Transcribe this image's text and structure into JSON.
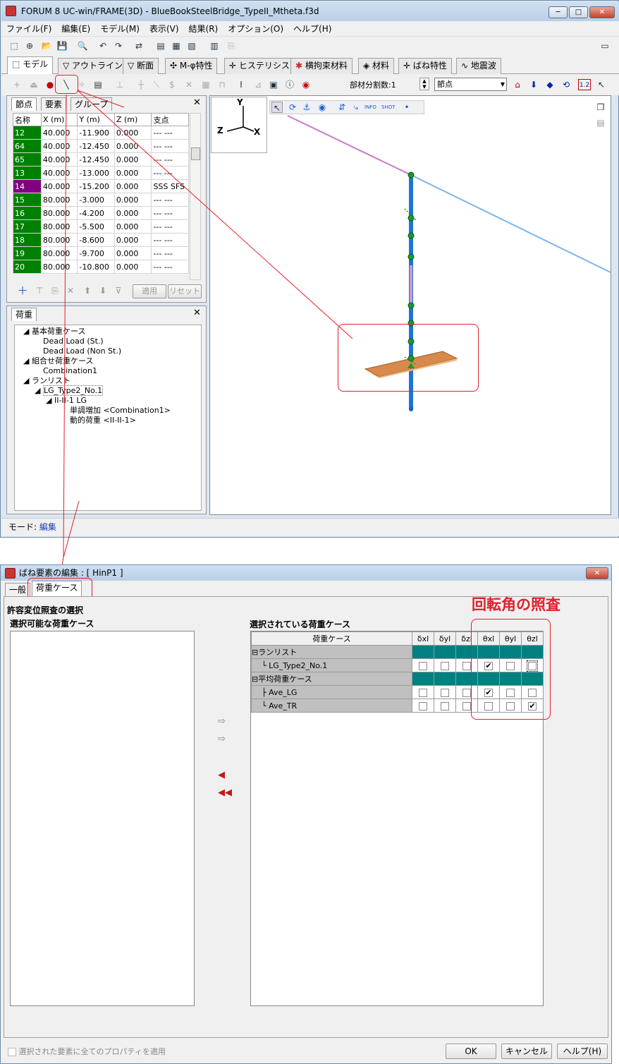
{
  "app": {
    "title": "FORUM 8  UC-win/FRAME(3D) - BlueBookSteelBridge_TypeII_Mtheta.f3d",
    "window_buttons": {
      "minimize": "─",
      "maximize": "□",
      "close": "✕"
    }
  },
  "menu": [
    "ファイル(F)",
    "編集(E)",
    "モデル(M)",
    "表示(V)",
    "結果(R)",
    "オプション(O)",
    "ヘルプ(H)"
  ],
  "main_tabs": [
    "モデル",
    "アウトライン",
    "断面",
    "M-φ特性",
    "ヒステリシス",
    "横拘束材料",
    "材料",
    "ばね特性",
    "地震波"
  ],
  "toolbar2": {
    "division_label": "部材分割数:1",
    "select_value": "節点",
    "tool_value": "1.2"
  },
  "node_panel": {
    "tabs": [
      "節点",
      "要素",
      "グループ"
    ],
    "columns": [
      "名称",
      "X (m)",
      "Y (m)",
      "Z (m)",
      "支点"
    ],
    "rows": [
      {
        "name": "12",
        "x": "40.000",
        "y": "-11.900",
        "z": "0.000",
        "support": "--- ---",
        "color": "#008000"
      },
      {
        "name": "64",
        "x": "40.000",
        "y": "-12.450",
        "z": "0.000",
        "support": "--- ---",
        "color": "#008000"
      },
      {
        "name": "65",
        "x": "40.000",
        "y": "-12.450",
        "z": "0.000",
        "support": "--- ---",
        "color": "#008000"
      },
      {
        "name": "13",
        "x": "40.000",
        "y": "-13.000",
        "z": "0.000",
        "support": "--- ---",
        "color": "#008000"
      },
      {
        "name": "14",
        "x": "40.000",
        "y": "-15.200",
        "z": "0.000",
        "support": "SSS SFS",
        "color": "#800080"
      },
      {
        "name": "15",
        "x": "80.000",
        "y": "-3.000",
        "z": "0.000",
        "support": "--- ---",
        "color": "#008000"
      },
      {
        "name": "16",
        "x": "80.000",
        "y": "-4.200",
        "z": "0.000",
        "support": "--- ---",
        "color": "#008000"
      },
      {
        "name": "17",
        "x": "80.000",
        "y": "-5.500",
        "z": "0.000",
        "support": "--- ---",
        "color": "#008000"
      },
      {
        "name": "18",
        "x": "80.000",
        "y": "-8.600",
        "z": "0.000",
        "support": "--- ---",
        "color": "#008000"
      },
      {
        "name": "19",
        "x": "80.000",
        "y": "-9.700",
        "z": "0.000",
        "support": "--- ---",
        "color": "#008000"
      },
      {
        "name": "20",
        "x": "80.000",
        "y": "-10.800",
        "z": "0.000",
        "support": "--- ---",
        "color": "#008000"
      }
    ],
    "apply_label": "適用",
    "reset_label": "リセット"
  },
  "load_panel": {
    "tab": "荷重",
    "tree": [
      {
        "label": "基本荷重ケース",
        "level": 0
      },
      {
        "label": "Dead Load (St.)",
        "level": 1
      },
      {
        "label": "Dead Load (Non St.)",
        "level": 1
      },
      {
        "label": "組合せ荷重ケース",
        "level": 0
      },
      {
        "label": "Combination1",
        "level": 1
      },
      {
        "label": "ランリスト",
        "level": 0
      },
      {
        "label": "LG_Type2_No.1",
        "level": 1
      },
      {
        "label": "II-II-1 LG",
        "level": 2
      },
      {
        "label": "単調増加 <Combination1>",
        "level": 3
      },
      {
        "label": "動的荷重 <II-II-1>",
        "level": 3
      }
    ]
  },
  "axes": {
    "y": "Y",
    "z": "Z",
    "x": "X"
  },
  "status": {
    "mode_label": "モード:",
    "mode_value": "編集"
  },
  "dialog": {
    "title": "ばね要素の編集 : [ HinP1 ]",
    "tabs": [
      "一般",
      "荷重ケース"
    ],
    "section_title": "許容変位照査の選択",
    "available_label": "選択可能な荷重ケース",
    "selected_label": "選択されている荷重ケース",
    "annotation": "回転角の照査",
    "columns": [
      "荷重ケース",
      "δxl",
      "δyl",
      "δzl",
      "θxl",
      "θyl",
      "θzl"
    ],
    "groups": [
      {
        "name": "ランリスト",
        "items": [
          {
            "name": "LG_Type2_No.1",
            "checks": [
              false,
              false,
              false,
              true,
              false,
              false
            ]
          }
        ]
      },
      {
        "name": "平均荷重ケース",
        "items": [
          {
            "name": "Ave_LG",
            "checks": [
              false,
              false,
              false,
              true,
              false,
              false
            ]
          },
          {
            "name": "Ave_TR",
            "checks": [
              false,
              false,
              false,
              false,
              false,
              true
            ]
          }
        ]
      }
    ],
    "apply_all_label": "選択された要素に全てのプロパティを適用",
    "ok_label": "OK",
    "cancel_label": "キャンセル",
    "help_label": "ヘルプ(H)"
  }
}
